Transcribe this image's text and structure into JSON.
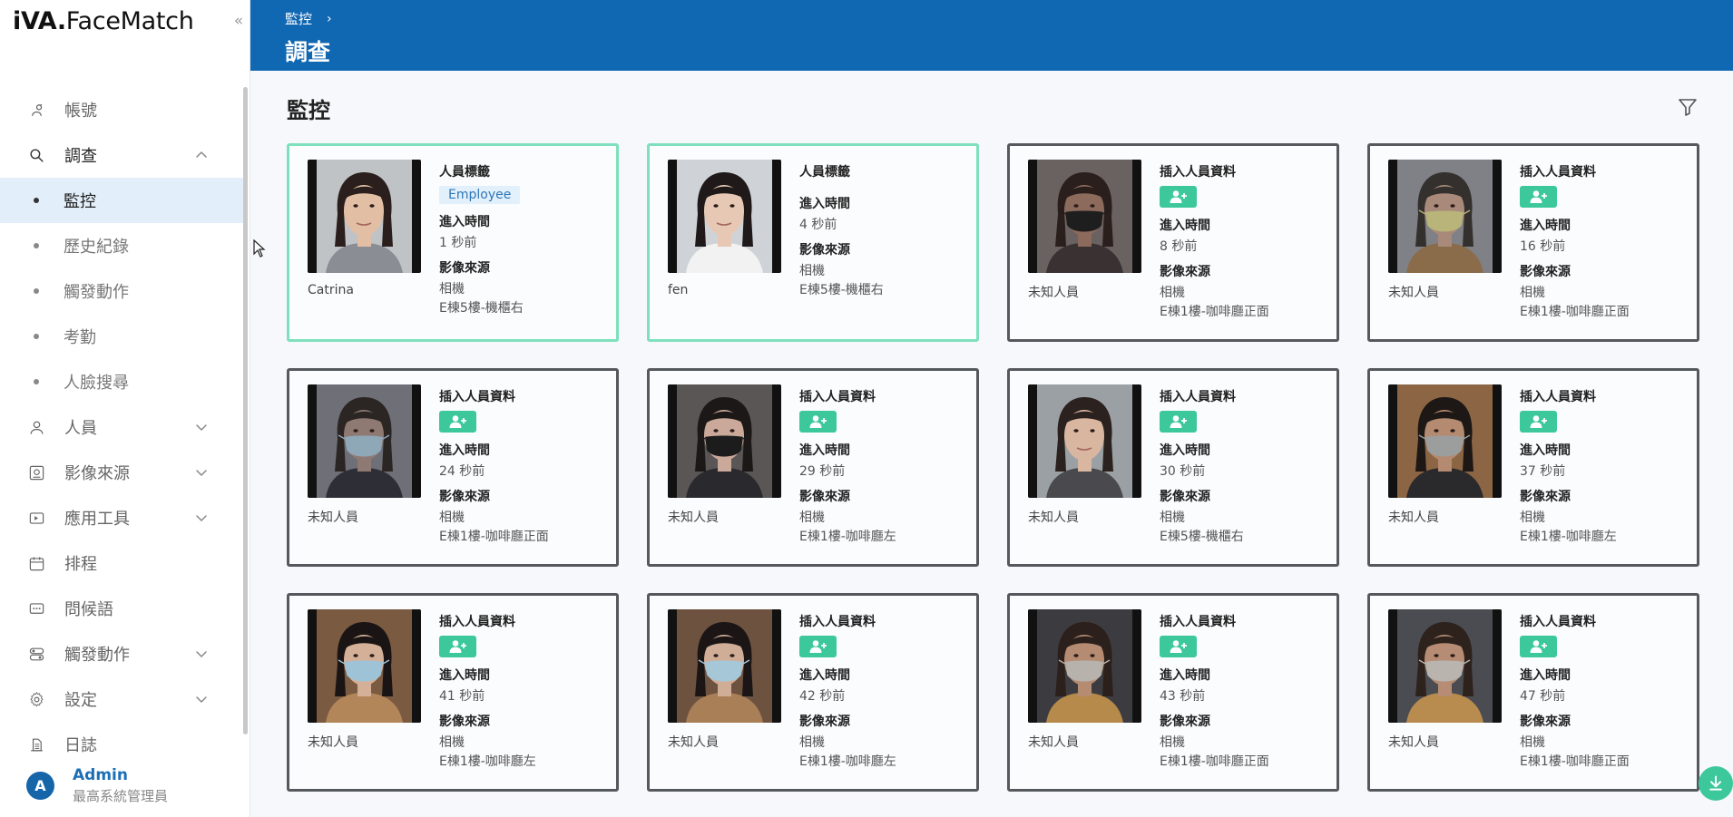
{
  "app": {
    "brand_bold": "iVA.",
    "brand_rest": "FaceMatch"
  },
  "sidebar": {
    "collapse_symbol": "«",
    "items": [
      {
        "label": "帳號",
        "icon": "account-icon",
        "expandable": false
      },
      {
        "label": "調查",
        "icon": "search-icon",
        "expandable": true,
        "open": true
      },
      {
        "label": "人員",
        "icon": "person-icon",
        "expandable": true
      },
      {
        "label": "影像來源",
        "icon": "camera-source-icon",
        "expandable": true
      },
      {
        "label": "應用工具",
        "icon": "tools-icon",
        "expandable": true
      },
      {
        "label": "排程",
        "icon": "calendar-icon",
        "expandable": false
      },
      {
        "label": "問候語",
        "icon": "greeting-icon",
        "expandable": false
      },
      {
        "label": "觸發動作",
        "icon": "trigger-icon",
        "expandable": true
      },
      {
        "label": "設定",
        "icon": "gear-icon",
        "expandable": true
      },
      {
        "label": "日誌",
        "icon": "log-icon",
        "expandable": false
      }
    ],
    "sub_items": [
      {
        "label": "監控",
        "active": true
      },
      {
        "label": "歷史紀錄"
      },
      {
        "label": "觸發動作"
      },
      {
        "label": "考勤"
      },
      {
        "label": "人臉搜尋"
      }
    ],
    "user": {
      "initial": "A",
      "name": "Admin",
      "role": "最高系統管理員"
    }
  },
  "header": {
    "breadcrumb": "監控",
    "breadcrumb_sep": "›",
    "title": "調查"
  },
  "main": {
    "title": "監控"
  },
  "labels": {
    "person_tag": "人員標籤",
    "insert_person": "插入人員資料",
    "entry_time": "進入時間",
    "video_source": "影像來源"
  },
  "cards": [
    {
      "known": true,
      "name": "Catrina",
      "tag": "Employee",
      "time": "1 秒前",
      "source_type": "相機",
      "location": "E棟5樓-機櫃右",
      "skin": "#e2bfa4",
      "hair": "#2a1f1c",
      "bg": "#bfc3c6",
      "shirt": "#8a8e94",
      "mask": false
    },
    {
      "known": true,
      "name": "fen",
      "tag": "",
      "time": "4 秒前",
      "source_type": "相機",
      "location": "E棟5樓-機櫃右",
      "skin": "#e6c8b4",
      "hair": "#1f1a19",
      "bg": "#cfd3d8",
      "shirt": "#f2f2f2",
      "mask": false
    },
    {
      "known": false,
      "name": "未知人員",
      "tag": "",
      "time": "8 秒前",
      "source_type": "相機",
      "location": "E棟1樓-咖啡廳正面",
      "skin": "#8c6a5c",
      "hair": "#2b1f1d",
      "bg": "#6a6260",
      "shirt": "#3a3232",
      "mask": true,
      "mask_color": "#1e1e1e"
    },
    {
      "known": false,
      "name": "未知人員",
      "tag": "",
      "time": "16 秒前",
      "source_type": "相機",
      "location": "E棟1樓-咖啡廳正面",
      "skin": "#a9897a",
      "hair": "#34302e",
      "bg": "#7f8186",
      "shirt": "#8a6c4a",
      "mask": true,
      "mask_color": "#b8b47a"
    },
    {
      "known": false,
      "name": "未知人員",
      "tag": "",
      "time": "24 秒前",
      "source_type": "相機",
      "location": "E棟1樓-咖啡廳正面",
      "skin": "#8e7a72",
      "hair": "#2b2624",
      "bg": "#6f7077",
      "shirt": "#2e2e36",
      "mask": true,
      "mask_color": "#8fa8b8"
    },
    {
      "known": false,
      "name": "未知人員",
      "tag": "",
      "time": "29 秒前",
      "source_type": "相機",
      "location": "E棟1樓-咖啡廳左",
      "skin": "#caa99a",
      "hair": "#1c1818",
      "bg": "#5a5656",
      "shirt": "#2a2a2e",
      "mask": true,
      "mask_color": "#1c1c1c"
    },
    {
      "known": false,
      "name": "未知人員",
      "tag": "",
      "time": "30 秒前",
      "source_type": "相機",
      "location": "E棟5樓-機櫃右",
      "skin": "#d9b6a0",
      "hair": "#2b211e",
      "bg": "#9aa0a4",
      "shirt": "#4a4a4e",
      "mask": false
    },
    {
      "known": false,
      "name": "未知人員",
      "tag": "",
      "time": "37 秒前",
      "source_type": "相機",
      "location": "E棟1樓-咖啡廳左",
      "skin": "#b48a70",
      "hair": "#1d1715",
      "bg": "#8c6644",
      "shirt": "#2a2a2c",
      "mask": true,
      "mask_color": "#9c9e9e"
    },
    {
      "known": false,
      "name": "未知人員",
      "tag": "",
      "time": "41 秒前",
      "source_type": "相機",
      "location": "E棟1樓-咖啡廳左",
      "skin": "#d4b099",
      "hair": "#1a1514",
      "bg": "#7a5a40",
      "shirt": "#b3865a",
      "mask": true,
      "mask_color": "#9fc3d6"
    },
    {
      "known": false,
      "name": "未知人員",
      "tag": "",
      "time": "42 秒前",
      "source_type": "相機",
      "location": "E棟1樓-咖啡廳左",
      "skin": "#d0ad96",
      "hair": "#1b1615",
      "bg": "#6e5240",
      "shirt": "#a87f57",
      "mask": true,
      "mask_color": "#a6c7d8"
    },
    {
      "known": false,
      "name": "未知人員",
      "tag": "",
      "time": "43 秒前",
      "source_type": "相機",
      "location": "E棟1樓-咖啡廳正面",
      "skin": "#b58c72",
      "hair": "#2b201c",
      "bg": "#3c3c40",
      "shirt": "#b58a4a",
      "mask": true,
      "mask_color": "#b8b2ac"
    },
    {
      "known": false,
      "name": "未知人員",
      "tag": "",
      "time": "47 秒前",
      "source_type": "相機",
      "location": "E棟1樓-咖啡廳正面",
      "skin": "#b68d74",
      "hair": "#2e221d",
      "bg": "#4a4c52",
      "shirt": "#b88c4e",
      "mask": true,
      "mask_color": "#b9b5ae"
    }
  ]
}
